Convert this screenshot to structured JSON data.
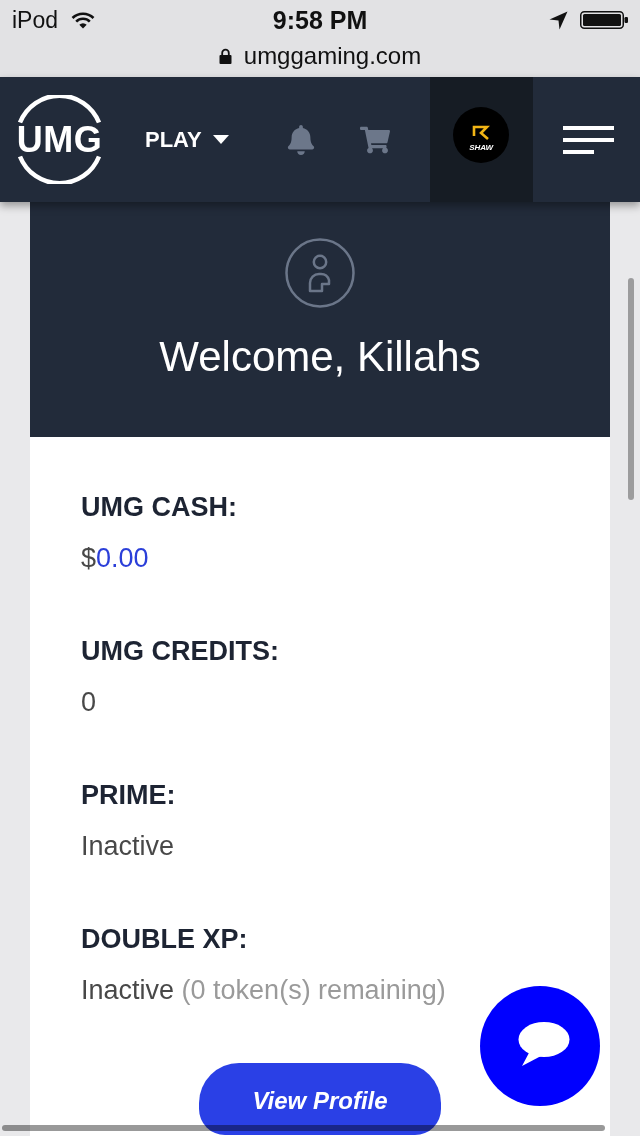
{
  "status_bar": {
    "carrier": "iPod",
    "time": "9:58 PM"
  },
  "address_bar": {
    "url": "umggaming.com"
  },
  "nav": {
    "logo": "UMG",
    "play_menu": "PLAY",
    "avatar_label": "SHAW"
  },
  "welcome": {
    "title": "Welcome, Killahs"
  },
  "stats": [
    {
      "kind": "money",
      "label": "UMG CASH:",
      "prefix": "$",
      "value": "0.00"
    },
    {
      "kind": "plain",
      "label": "UMG CREDITS:",
      "value": "0"
    },
    {
      "kind": "plain",
      "label": "PRIME:",
      "value": "Inactive"
    },
    {
      "kind": "with_note",
      "label": "DOUBLE XP:",
      "value": "Inactive",
      "note": "(0 token(s) remaining)"
    }
  ],
  "profile_button": {
    "label": "View Profile"
  }
}
